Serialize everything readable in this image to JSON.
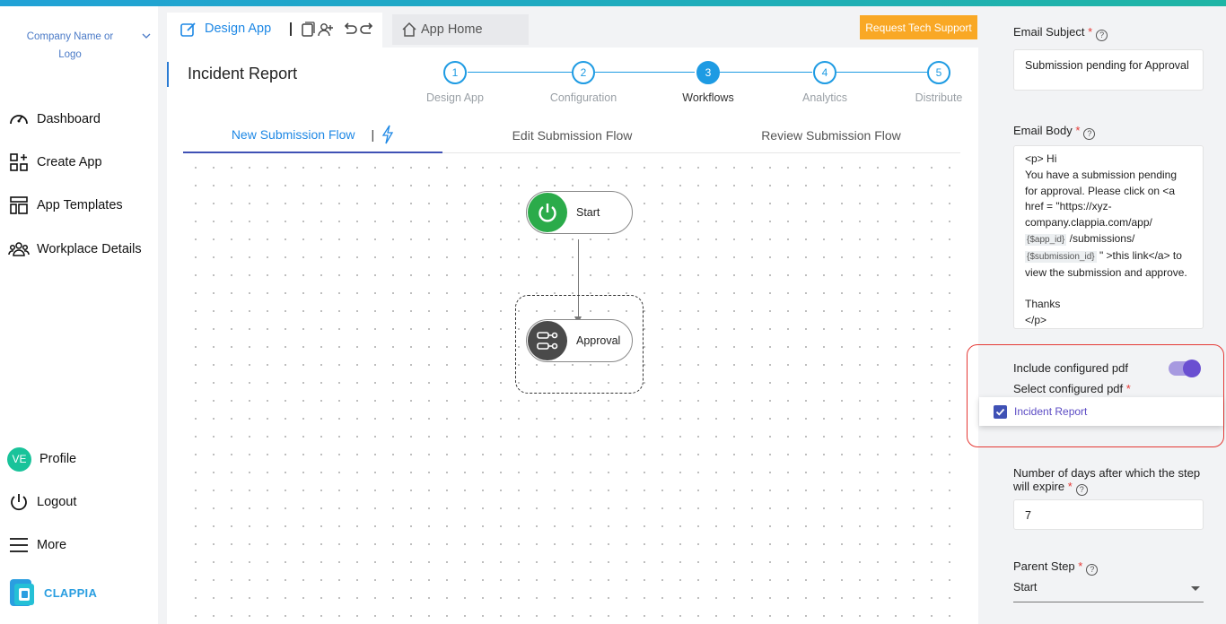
{
  "colors": {
    "accent": "#1e88e5",
    "support": "#f9a825",
    "highlight": "#e53935",
    "toggle": "#6a4fd1",
    "start": "#2bab4a",
    "approval": "#4a4a4a"
  },
  "sidebar": {
    "company": "Company Name or Logo",
    "items": [
      {
        "label": "Dashboard",
        "icon": "dashboard-icon"
      },
      {
        "label": "Create App",
        "icon": "create-app-icon"
      },
      {
        "label": "App Templates",
        "icon": "templates-icon"
      },
      {
        "label": "Workplace Details",
        "icon": "workplace-icon"
      }
    ],
    "profile": {
      "initials": "VE",
      "label": "Profile"
    },
    "logout": "Logout",
    "more": "More",
    "brand": "CLAPPIA"
  },
  "toolbar": {
    "design_label": "Design App",
    "app_home": "App Home",
    "support": "Request Tech Support"
  },
  "app_title": "Incident Report",
  "steps": [
    {
      "num": "1",
      "label": "Design App"
    },
    {
      "num": "2",
      "label": "Configuration"
    },
    {
      "num": "3",
      "label": "Workflows"
    },
    {
      "num": "4",
      "label": "Analytics"
    },
    {
      "num": "5",
      "label": "Distribute"
    }
  ],
  "tabs": {
    "new": "New Submission Flow",
    "pipe": "|",
    "edit": "Edit Submission Flow",
    "review": "Review Submission Flow"
  },
  "nodes": {
    "start": "Start",
    "approval": "Approval"
  },
  "right": {
    "email_subject_label": "Email Subject",
    "email_subject_value": "Submission pending for Approval",
    "email_body_label": "Email Body",
    "body": {
      "l1": "<p> Hi",
      "l2": "You have a submission pending for approval. Please click on <a href = \"https://xyz-company.clappia.com/app/",
      "chip1": "{$app_id}",
      "l3": "/submissions/",
      "chip2": "{$submission_id}",
      "l4": "\" >this link</a> to view the submission and approve.",
      "l5": "Thanks",
      "l6": "</p>"
    },
    "include_pdf_label": "Include configured pdf",
    "select_pdf_label": "Select configured pdf",
    "pdf_option": "Incident Report",
    "expire_label": "Number of days after which the step will expire",
    "expire_value": "7",
    "parent_label": "Parent Step",
    "parent_value": "Start",
    "req": "*",
    "help": "?"
  }
}
